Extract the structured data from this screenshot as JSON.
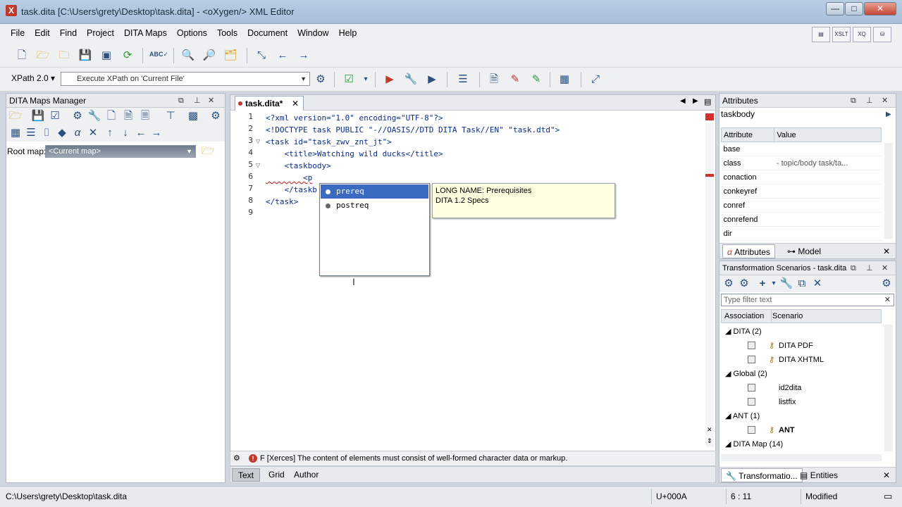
{
  "window": {
    "title": "task.dita [C:\\Users\\grety\\Desktop\\task.dita] - <oXygen/> XML Editor",
    "min": "—",
    "max": "□",
    "close": "✕"
  },
  "menu": [
    "File",
    "Edit",
    "Find",
    "Project",
    "DITA Maps",
    "Options",
    "Tools",
    "Document",
    "Window",
    "Help"
  ],
  "perspectives": [
    "",
    "XSLT",
    "XQ",
    ""
  ],
  "xpath": {
    "version": "XPath 2.0",
    "placeholder": "Execute XPath on  'Current File'"
  },
  "maps_panel": {
    "title": "DITA Maps Manager",
    "root_label": "Root map:",
    "root_value": "<Current map>"
  },
  "editor": {
    "tab": "task.dita*",
    "lines": [
      {
        "n": "1",
        "text": "<?xml version=\"1.0\" encoding=\"UTF-8\"?>"
      },
      {
        "n": "2",
        "text": "<!DOCTYPE task PUBLIC \"-//OASIS//DTD DITA Task//EN\" \"task.dtd\">"
      },
      {
        "n": "3",
        "text": "<task id=\"task_zwv_znt_jt\">"
      },
      {
        "n": "4",
        "text": "    <title>Watching wild ducks</title>"
      },
      {
        "n": "5",
        "text": "    <taskbody>"
      },
      {
        "n": "6",
        "text": "        <p"
      },
      {
        "n": "7",
        "text": "    </taskb"
      },
      {
        "n": "8",
        "text": "</task>"
      },
      {
        "n": "9",
        "text": ""
      }
    ],
    "completion": [
      {
        "label": "prereq",
        "selected": true
      },
      {
        "label": "postreq",
        "selected": false
      }
    ],
    "doc_line1": "LONG NAME: Prerequisites",
    "doc_line2": "DITA 1.2 Specs",
    "problem": "F [Xerces] The content of elements must consist of well-formed character data or markup.",
    "modes": [
      "Text",
      "Grid",
      "Author"
    ]
  },
  "attributes_panel": {
    "title": "Attributes",
    "element": "taskbody",
    "col_attr": "Attribute",
    "col_value": "Value",
    "rows": [
      {
        "name": "base",
        "value": ""
      },
      {
        "name": "class",
        "value": "- topic/body task/ta..."
      },
      {
        "name": "conaction",
        "value": ""
      },
      {
        "name": "conkeyref",
        "value": ""
      },
      {
        "name": "conref",
        "value": ""
      },
      {
        "name": "conrefend",
        "value": ""
      },
      {
        "name": "dir",
        "value": ""
      }
    ],
    "tabs": [
      "Attributes",
      "Model"
    ]
  },
  "transform_panel": {
    "title": "Transformation Scenarios - task.dita",
    "filter_placeholder": "Type filter text",
    "col_assoc": "Association",
    "col_scenario": "Scenario",
    "groups": [
      {
        "label": "DITA (2)",
        "items": [
          "DITA PDF",
          "DITA XHTML"
        ]
      },
      {
        "label": "Global (2)",
        "items": [
          "id2dita",
          "listfix"
        ]
      },
      {
        "label": "ANT (1)",
        "items": [
          "ANT"
        ]
      },
      {
        "label": "DITA Map (14)",
        "items": []
      }
    ],
    "tabs": [
      "Transformatio...",
      "Entities"
    ]
  },
  "status": {
    "path": "C:\\Users\\grety\\Desktop\\task.dita",
    "unicode": "U+000A",
    "position": "6 : 11",
    "state": "Modified"
  }
}
